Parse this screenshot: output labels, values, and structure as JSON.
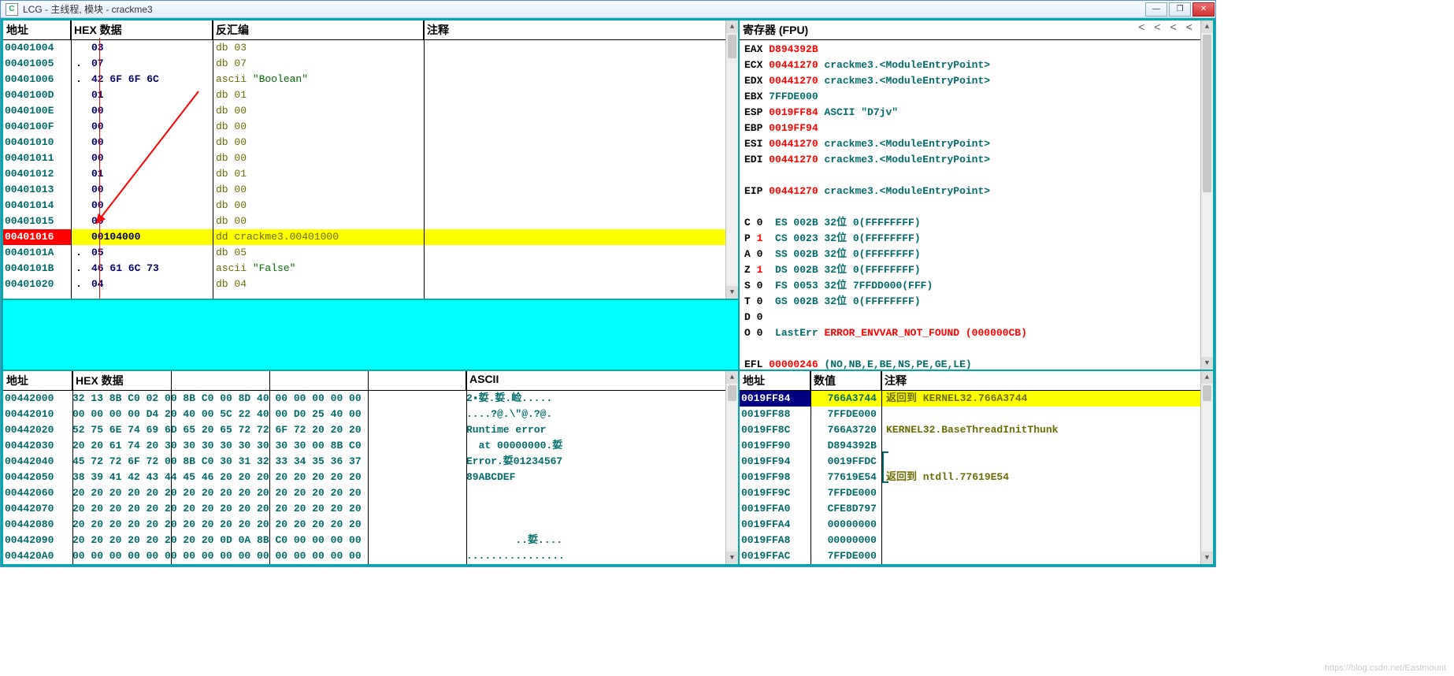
{
  "window": {
    "icon_letter": "C",
    "title": "LCG -  主线程, 模块 - crackme3"
  },
  "disasm": {
    "headers": {
      "addr": "地址",
      "hex": "HEX 数据",
      "asm": "反汇编",
      "comment": "注释"
    },
    "rows": [
      {
        "addr": "00401004",
        "dot": "",
        "hex": "03",
        "asm": "db 03",
        "hi": false
      },
      {
        "addr": "00401005",
        "dot": ".",
        "hex": "07",
        "asm": "db 07",
        "hi": false
      },
      {
        "addr": "00401006",
        "dot": ".",
        "hex": "42 6F 6F 6C",
        "asm": "ascii \"Boolean\"",
        "hi": false,
        "ascii": true
      },
      {
        "addr": "0040100D",
        "dot": "",
        "hex": "01",
        "asm": "db 01",
        "hi": false
      },
      {
        "addr": "0040100E",
        "dot": "",
        "hex": "00",
        "asm": "db 00",
        "hi": false
      },
      {
        "addr": "0040100F",
        "dot": "",
        "hex": "00",
        "asm": "db 00",
        "hi": false
      },
      {
        "addr": "00401010",
        "dot": "",
        "hex": "00",
        "asm": "db 00",
        "hi": false
      },
      {
        "addr": "00401011",
        "dot": "",
        "hex": "00",
        "asm": "db 00",
        "hi": false
      },
      {
        "addr": "00401012",
        "dot": "",
        "hex": "01",
        "asm": "db 01",
        "hi": false
      },
      {
        "addr": "00401013",
        "dot": "",
        "hex": "00",
        "asm": "db 00",
        "hi": false
      },
      {
        "addr": "00401014",
        "dot": "",
        "hex": "00",
        "asm": "db 00",
        "hi": false
      },
      {
        "addr": "00401015",
        "dot": "",
        "hex": "00",
        "asm": "db 00",
        "hi": false
      },
      {
        "addr": "00401016",
        "dot": "",
        "hex": "00104000",
        "asm": "dd crackme3.00401000",
        "hi": true
      },
      {
        "addr": "0040101A",
        "dot": ".",
        "hex": "05",
        "asm": "db 05",
        "hi": false
      },
      {
        "addr": "0040101B",
        "dot": ".",
        "hex": "46 61 6C 73",
        "asm": "ascii \"False\"",
        "hi": false,
        "ascii": true
      },
      {
        "addr": "00401020",
        "dot": ".",
        "hex": "04",
        "asm": "db 04",
        "hi": false
      }
    ]
  },
  "regs": {
    "title": "寄存器 (FPU)",
    "nav": [
      "<",
      "<",
      "<",
      "<",
      "<"
    ],
    "lines": [
      {
        "parts": [
          {
            "t": "EAX ",
            "c": "r-name"
          },
          {
            "t": "D894392B",
            "c": "r-hex"
          }
        ]
      },
      {
        "parts": [
          {
            "t": "ECX ",
            "c": "r-name"
          },
          {
            "t": "00441270",
            "c": "r-hex"
          },
          {
            "t": " crackme3.<ModuleEntryPoint>",
            "c": "r-txt"
          }
        ]
      },
      {
        "parts": [
          {
            "t": "EDX ",
            "c": "r-name"
          },
          {
            "t": "00441270",
            "c": "r-hex"
          },
          {
            "t": " crackme3.<ModuleEntryPoint>",
            "c": "r-txt"
          }
        ]
      },
      {
        "parts": [
          {
            "t": "EBX ",
            "c": "r-name"
          },
          {
            "t": "7FFDE000",
            "c": "r-txt"
          }
        ]
      },
      {
        "parts": [
          {
            "t": "ESP ",
            "c": "r-name"
          },
          {
            "t": "0019FF84",
            "c": "r-hex"
          },
          {
            "t": " ASCII \"D7jv\"",
            "c": "r-txt"
          }
        ]
      },
      {
        "parts": [
          {
            "t": "EBP ",
            "c": "r-name"
          },
          {
            "t": "0019FF94",
            "c": "r-hex"
          }
        ]
      },
      {
        "parts": [
          {
            "t": "ESI ",
            "c": "r-name"
          },
          {
            "t": "00441270",
            "c": "r-hex"
          },
          {
            "t": " crackme3.<ModuleEntryPoint>",
            "c": "r-txt"
          }
        ]
      },
      {
        "parts": [
          {
            "t": "EDI ",
            "c": "r-name"
          },
          {
            "t": "00441270",
            "c": "r-hex"
          },
          {
            "t": " crackme3.<ModuleEntryPoint>",
            "c": "r-txt"
          }
        ]
      },
      {
        "parts": [
          {
            "t": " ",
            "c": ""
          }
        ]
      },
      {
        "parts": [
          {
            "t": "EIP ",
            "c": "r-name"
          },
          {
            "t": "00441270",
            "c": "r-hex"
          },
          {
            "t": " crackme3.<ModuleEntryPoint>",
            "c": "r-txt"
          }
        ]
      },
      {
        "parts": [
          {
            "t": " ",
            "c": ""
          }
        ]
      },
      {
        "parts": [
          {
            "t": "C ",
            "c": "r-name"
          },
          {
            "t": "0",
            "c": "r-name"
          },
          {
            "t": "  ES 002B 32位 0(FFFFFFFF)",
            "c": "r-txt"
          }
        ]
      },
      {
        "parts": [
          {
            "t": "P ",
            "c": "r-name"
          },
          {
            "t": "1",
            "c": "r-hex"
          },
          {
            "t": "  CS 0023 32位 0(FFFFFFFF)",
            "c": "r-txt"
          }
        ]
      },
      {
        "parts": [
          {
            "t": "A ",
            "c": "r-name"
          },
          {
            "t": "0",
            "c": "r-name"
          },
          {
            "t": "  SS 002B 32位 0(FFFFFFFF)",
            "c": "r-txt"
          }
        ]
      },
      {
        "parts": [
          {
            "t": "Z ",
            "c": "r-name"
          },
          {
            "t": "1",
            "c": "r-hex"
          },
          {
            "t": "  DS 002B 32位 0(FFFFFFFF)",
            "c": "r-txt"
          }
        ]
      },
      {
        "parts": [
          {
            "t": "S ",
            "c": "r-name"
          },
          {
            "t": "0",
            "c": "r-name"
          },
          {
            "t": "  FS 0053 32位 7FFDD000(FFF)",
            "c": "r-txt"
          }
        ]
      },
      {
        "parts": [
          {
            "t": "T ",
            "c": "r-name"
          },
          {
            "t": "0",
            "c": "r-name"
          },
          {
            "t": "  GS 002B 32位 0(FFFFFFFF)",
            "c": "r-txt"
          }
        ]
      },
      {
        "parts": [
          {
            "t": "D ",
            "c": "r-name"
          },
          {
            "t": "0",
            "c": "r-name"
          }
        ]
      },
      {
        "parts": [
          {
            "t": "O ",
            "c": "r-name"
          },
          {
            "t": "0",
            "c": "r-name"
          },
          {
            "t": "  LastErr ",
            "c": "r-txt"
          },
          {
            "t": "ERROR_ENVVAR_NOT_FOUND (000000CB)",
            "c": "r-hex"
          }
        ]
      },
      {
        "parts": [
          {
            "t": " ",
            "c": ""
          }
        ]
      },
      {
        "parts": [
          {
            "t": "EFL ",
            "c": "r-name"
          },
          {
            "t": "00000246",
            "c": "r-hex"
          },
          {
            "t": " (NO,NB,E,BE,NS,PE,GE,LE)",
            "c": "r-txt"
          }
        ]
      }
    ]
  },
  "dump": {
    "headers": {
      "addr": "地址",
      "hex": "HEX 数据",
      "ascii": "ASCII"
    },
    "rows": [
      {
        "a": "00442000",
        "h": "32 13 8B C0 02 00 8B C0 00 8D 40 00 00 00 00 00",
        "s": "2▪娎.娎.崄....."
      },
      {
        "a": "00442010",
        "h": "00 00 00 00 D4 20 40 00 5C 22 40 00 D0 25 40 00",
        "s": "....?@.\\\"@.?@."
      },
      {
        "a": "00442020",
        "h": "52 75 6E 74 69 6D 65 20 65 72 72 6F 72 20 20 20",
        "s": "Runtime error   "
      },
      {
        "a": "00442030",
        "h": "20 20 61 74 20 30 30 30 30 30 30 30 30 00 8B C0",
        "s": "  at 00000000.娎"
      },
      {
        "a": "00442040",
        "h": "45 72 72 6F 72 00 8B C0 30 31 32 33 34 35 36 37",
        "s": "Error.娎01234567"
      },
      {
        "a": "00442050",
        "h": "38 39 41 42 43 44 45 46 20 20 20 20 20 20 20 20",
        "s": "89ABCDEF        "
      },
      {
        "a": "00442060",
        "h": "20 20 20 20 20 20 20 20 20 20 20 20 20 20 20 20",
        "s": "                "
      },
      {
        "a": "00442070",
        "h": "20 20 20 20 20 20 20 20 20 20 20 20 20 20 20 20",
        "s": "                "
      },
      {
        "a": "00442080",
        "h": "20 20 20 20 20 20 20 20 20 20 20 20 20 20 20 20",
        "s": "                "
      },
      {
        "a": "00442090",
        "h": "20 20 20 20 20 20 20 20 0D 0A 8B C0 00 00 00 00",
        "s": "        ..娎...."
      },
      {
        "a": "004420A0",
        "h": "00 00 00 00 00 00 00 00 00 00 00 00 00 00 00 00",
        "s": "................"
      }
    ]
  },
  "stack": {
    "headers": {
      "addr": "地址",
      "val": "数值",
      "comment": "注释"
    },
    "rows": [
      {
        "a": "0019FF84",
        "v": "766A3744",
        "c": "返回到 KERNEL32.766A3744",
        "hi": true
      },
      {
        "a": "0019FF88",
        "v": "7FFDE000",
        "c": ""
      },
      {
        "a": "0019FF8C",
        "v": "766A3720",
        "c": "KERNEL32.BaseThreadInitThunk"
      },
      {
        "a": "0019FF90",
        "v": "D894392B",
        "c": ""
      },
      {
        "a": "0019FF94",
        "v": "0019FFDC",
        "c": ""
      },
      {
        "a": "0019FF98",
        "v": "77619E54",
        "c": "返回到 ntdll.77619E54"
      },
      {
        "a": "0019FF9C",
        "v": "7FFDE000",
        "c": ""
      },
      {
        "a": "0019FFA0",
        "v": "CFE8D797",
        "c": ""
      },
      {
        "a": "0019FFA4",
        "v": "00000000",
        "c": ""
      },
      {
        "a": "0019FFA8",
        "v": "00000000",
        "c": ""
      },
      {
        "a": "0019FFAC",
        "v": "7FFDE000",
        "c": ""
      }
    ]
  },
  "watermark": "https://blog.csdn.net/Eastmount"
}
